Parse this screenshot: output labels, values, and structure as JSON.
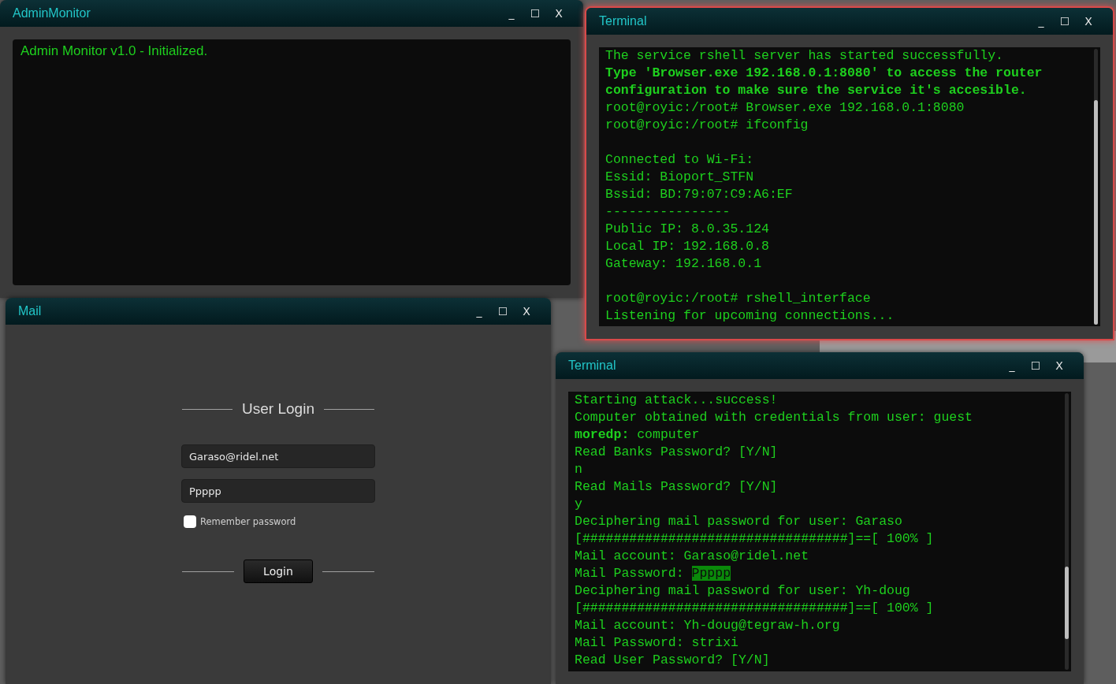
{
  "windows": [
    {
      "kind": "console",
      "title": "AdminMonitor",
      "focused": false,
      "controls": [
        "_",
        "☐",
        "X"
      ],
      "text": "Admin Monitor v1.0 - Initialized."
    },
    {
      "kind": "terminal",
      "title": "Terminal",
      "focused": true,
      "controls": [
        "_",
        "☐",
        "X"
      ],
      "lines": [
        {
          "kind": "text",
          "text": "The service rshell server has started successfully.",
          "bold": false
        },
        {
          "kind": "text",
          "text": "Type 'Browser.exe 192.168.0.1:8080' to access the router",
          "bold": true
        },
        {
          "kind": "text",
          "text": "configuration to make sure the service it's accesible.",
          "bold": true
        },
        {
          "kind": "text",
          "text": "root@royic:/root# Browser.exe 192.168.0.1:8080",
          "bold": false
        },
        {
          "kind": "text",
          "text": "root@royic:/root# ifconfig",
          "bold": false
        },
        {
          "kind": "blank"
        },
        {
          "kind": "text",
          "text": "Connected to Wi-Fi:",
          "bold": false
        },
        {
          "kind": "text",
          "text": "Essid: Bioport_STFN",
          "bold": false
        },
        {
          "kind": "text",
          "text": "Bssid: BD:79:07:C9:A6:EF",
          "bold": false
        },
        {
          "kind": "text",
          "text": "----------------",
          "bold": false
        },
        {
          "kind": "text",
          "text": "Public IP: 8.0.35.124",
          "bold": false
        },
        {
          "kind": "text",
          "text": "Local IP: 192.168.0.8",
          "bold": false
        },
        {
          "kind": "text",
          "text": "Gateway: 192.168.0.1",
          "bold": false
        },
        {
          "kind": "blank"
        },
        {
          "kind": "text",
          "text": "root@royic:/root# rshell_interface",
          "bold": false
        },
        {
          "kind": "text",
          "text": "Listening for upcoming connections...",
          "bold": false
        }
      ]
    },
    {
      "kind": "login",
      "title": "Mail",
      "focused": false,
      "controls": [
        "_",
        "☐",
        "X"
      ],
      "heading": "User Login",
      "email": "Garaso@ridel.net",
      "password": "Ppppp",
      "remember": {
        "label": "Remember password",
        "checked": false
      },
      "button": "Login"
    },
    {
      "kind": "terminal",
      "title": "Terminal",
      "focused": false,
      "controls": [
        "_",
        "☐",
        "X"
      ],
      "lines": [
        {
          "kind": "text",
          "text": "Starting attack...success!",
          "bold": false
        },
        {
          "kind": "text",
          "text": "Computer obtained with credentials from user: guest",
          "bold": false
        },
        {
          "kind": "text",
          "text": "**moredp:** computer",
          "bold": false
        },
        {
          "kind": "text",
          "text": "Read Banks Password? [Y/N]",
          "bold": false
        },
        {
          "kind": "text",
          "text": "n",
          "bold": false
        },
        {
          "kind": "text",
          "text": "Read Mails Password? [Y/N]",
          "bold": false
        },
        {
          "kind": "text",
          "text": "y",
          "bold": false
        },
        {
          "kind": "text",
          "text": "Deciphering mail password for user: Garaso",
          "bold": false
        },
        {
          "kind": "text",
          "text": "[##################################]==[ 100% ]",
          "bold": false
        },
        {
          "kind": "text",
          "text": "Mail account: Garaso@ridel.net",
          "bold": false
        },
        {
          "kind": "text",
          "text": "Mail Password: ",
          "highlight": "Ppppp",
          "bold": false
        },
        {
          "kind": "text",
          "text": "Deciphering mail password for user: Yh-doug",
          "bold": false
        },
        {
          "kind": "text",
          "text": "[##################################]==[ 100% ]",
          "bold": false
        },
        {
          "kind": "text",
          "text": "Mail account: Yh-doug@tegraw-h.org",
          "bold": false
        },
        {
          "kind": "text",
          "text": "Mail Password: strixi",
          "bold": false
        },
        {
          "kind": "text",
          "text": "Read User Password? [Y/N]",
          "bold": false
        }
      ]
    }
  ]
}
